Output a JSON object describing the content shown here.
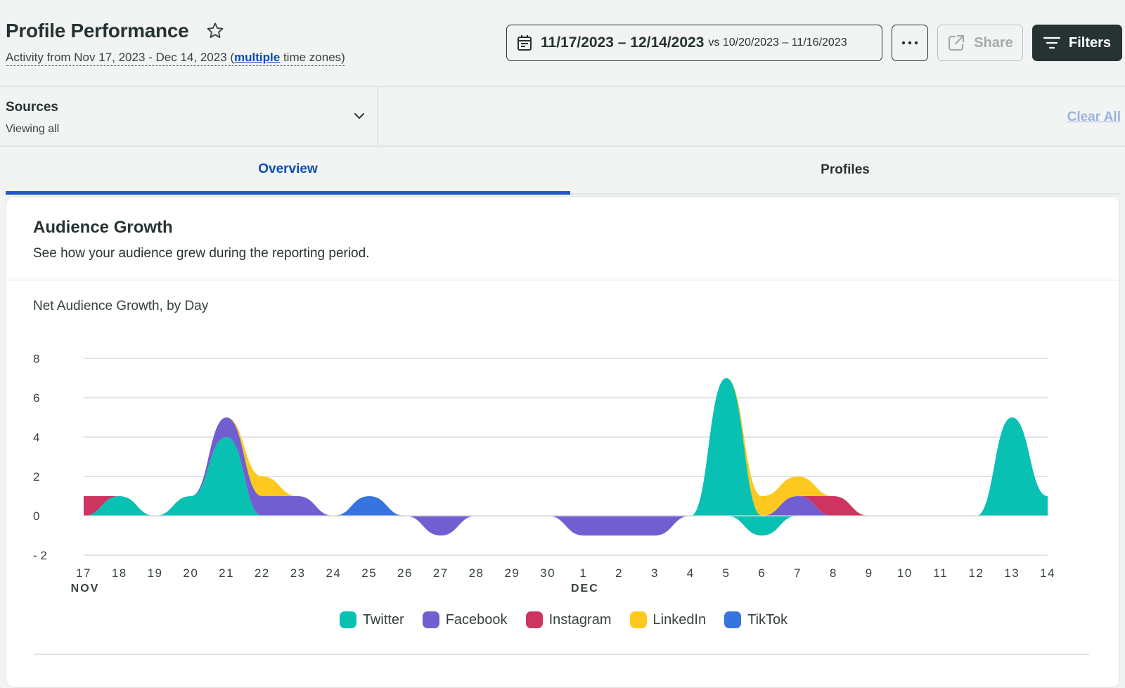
{
  "header": {
    "title": "Profile Performance",
    "subtitle_prefix": "Activity from Nov 17, 2023 - Dec 14, 2023 (",
    "subtitle_link": "multiple",
    "subtitle_suffix": " time zones)",
    "date_range": "11/17/2023 – 12/14/2023",
    "vs_label": "vs",
    "compare_range": "10/20/2023 – 11/16/2023",
    "more_icon": "ellipsis-icon",
    "share_label": "Share",
    "filters_label": "Filters"
  },
  "filter_bar": {
    "sources_label": "Sources",
    "sources_value": "Viewing all",
    "clear_all_label": "Clear All"
  },
  "tabs": [
    {
      "label": "Overview",
      "active": true
    },
    {
      "label": "Profiles",
      "active": false
    }
  ],
  "card": {
    "title": "Audience Growth",
    "description": "See how your audience grew during the reporting period."
  },
  "chart_data": {
    "type": "area",
    "stacked": true,
    "title": "Net Audience Growth, by Day",
    "xlabel": "",
    "ylabel": "",
    "ylim": [
      -2,
      8
    ],
    "yticks": [
      8,
      6,
      4,
      2,
      0,
      -2
    ],
    "grid": true,
    "legend_position": "bottom-center",
    "categories": [
      "17",
      "18",
      "19",
      "20",
      "21",
      "22",
      "23",
      "24",
      "25",
      "26",
      "27",
      "28",
      "29",
      "30",
      "1",
      "2",
      "3",
      "4",
      "5",
      "6",
      "7",
      "8",
      "9",
      "10",
      "11",
      "12",
      "13",
      "14"
    ],
    "month_labels": [
      {
        "index": 0,
        "label": "NOV"
      },
      {
        "index": 14,
        "label": "DEC"
      }
    ],
    "series": [
      {
        "name": "Twitter",
        "color": "#08c1b2",
        "values": [
          0,
          1,
          0,
          1,
          4,
          0,
          0,
          0,
          0,
          0,
          0,
          0,
          0,
          0,
          0,
          0,
          0,
          0,
          7,
          -1,
          0,
          0,
          0,
          0,
          0,
          0,
          5,
          1
        ]
      },
      {
        "name": "Facebook",
        "color": "#715fd1",
        "values": [
          0,
          0,
          0,
          0,
          1,
          1,
          1,
          0,
          0,
          0,
          -1,
          0,
          0,
          0,
          -1,
          -1,
          -1,
          0,
          0,
          0,
          1,
          0,
          0,
          0,
          0,
          0,
          0,
          0
        ]
      },
      {
        "name": "Instagram",
        "color": "#cd3460",
        "values": [
          1,
          0,
          0,
          0,
          0,
          0,
          0,
          0,
          0,
          0,
          0,
          0,
          0,
          0,
          0,
          0,
          0,
          0,
          0,
          0,
          0,
          1,
          0,
          0,
          0,
          0,
          0,
          0
        ]
      },
      {
        "name": "LinkedIn",
        "color": "#fdc91e",
        "values": [
          0,
          0,
          0,
          0,
          0,
          1,
          0,
          0,
          0,
          0,
          0,
          0,
          0,
          0,
          0,
          0,
          0,
          0,
          0,
          1,
          1,
          0,
          0,
          0,
          0,
          0,
          0,
          0
        ]
      },
      {
        "name": "TikTok",
        "color": "#3874e0",
        "values": [
          0,
          0,
          0,
          0,
          0,
          0,
          0,
          0,
          1,
          0,
          0,
          0,
          0,
          0,
          0,
          0,
          0,
          0,
          0,
          0,
          0,
          0,
          0,
          0,
          0,
          0,
          0,
          0
        ]
      }
    ]
  }
}
